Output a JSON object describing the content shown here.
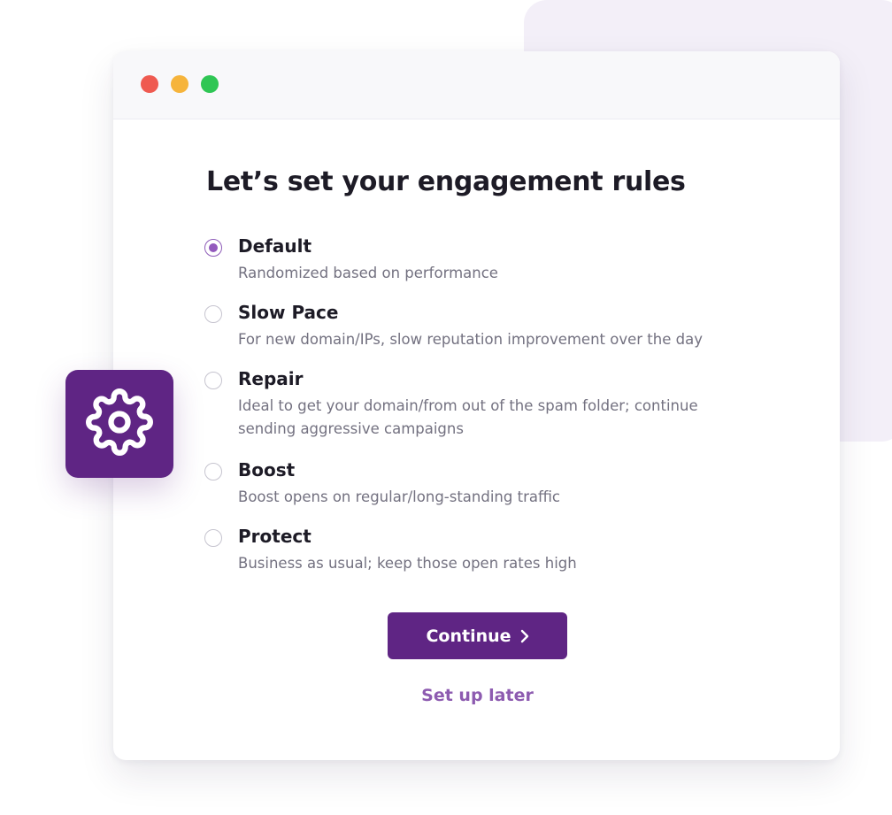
{
  "heading": "Let’s set your engagement rules",
  "options": [
    {
      "title": "Default",
      "description": "Randomized based on performance",
      "selected": true
    },
    {
      "title": "Slow Pace",
      "description": "For new domain/IPs, slow reputation improvement over the day",
      "selected": false
    },
    {
      "title": "Repair",
      "description": "Ideal to get your domain/from out of the spam folder; continue sending aggressive campaigns",
      "selected": false
    },
    {
      "title": "Boost",
      "description": "Boost opens on regular/long-standing traffic",
      "selected": false
    },
    {
      "title": "Protect",
      "description": "Business as usual; keep those open rates high",
      "selected": false
    }
  ],
  "buttons": {
    "continue_label": "Continue",
    "later_label": "Set up later"
  },
  "icons": {
    "badge": "gear-icon",
    "continue": "chevron-right-icon"
  },
  "colors": {
    "brand_purple": "#5f2584",
    "accent_purple": "#9359bd",
    "link_purple": "#8d5bb0",
    "background_panel": "#f3eff8",
    "window_dot_red": "#ef5a50",
    "window_dot_yellow": "#f6b43b",
    "window_dot_green": "#2fc654"
  }
}
